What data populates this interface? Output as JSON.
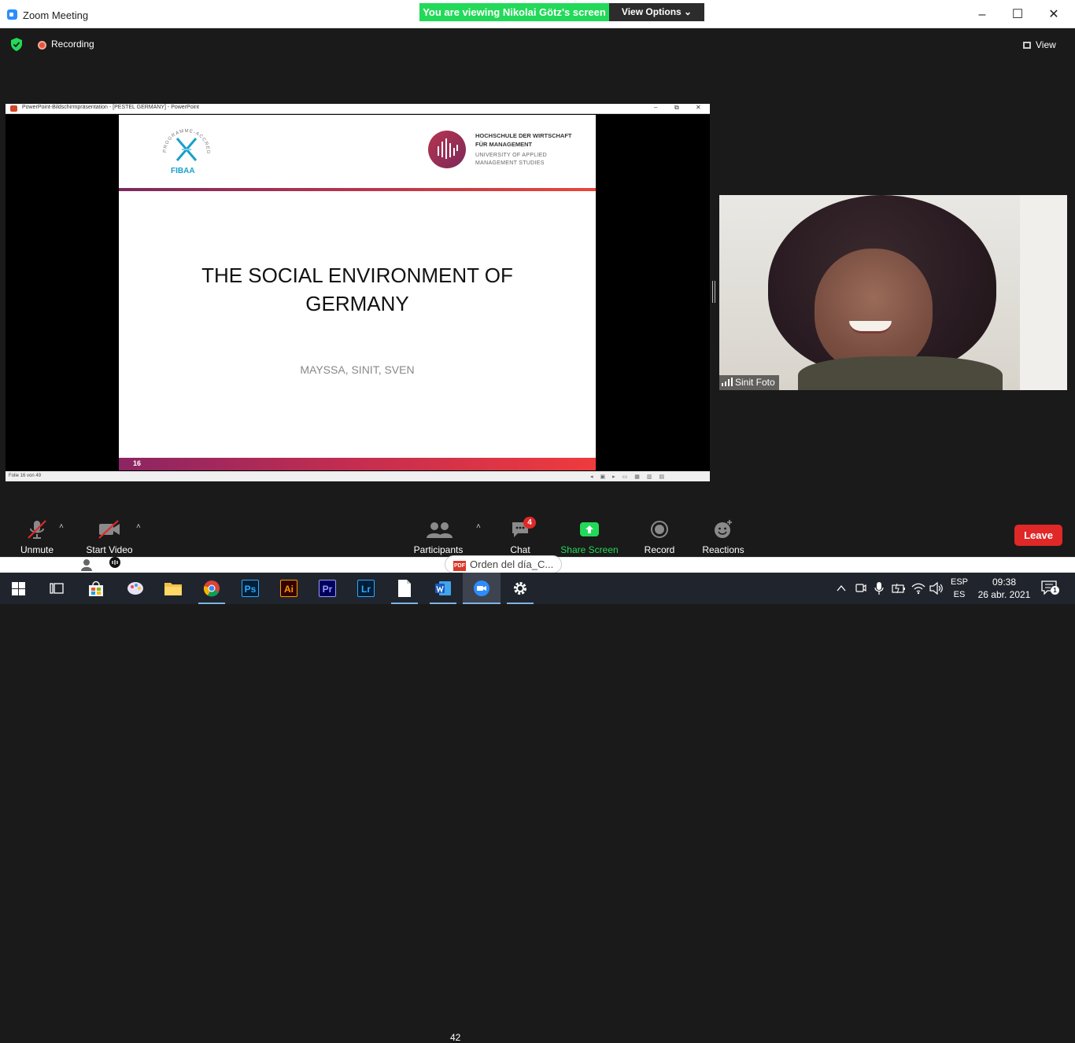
{
  "window": {
    "title": "Zoom Meeting",
    "minimize": "–",
    "maximize": "☐",
    "close": "✕"
  },
  "banner": {
    "viewing": "You are viewing Nikolai Götz's screen",
    "view_options": "View Options ⌄"
  },
  "meeting": {
    "recording_label": "Recording",
    "view_label": "View"
  },
  "shared_screen": {
    "window_title": "PowerPoint-Bildschirmpräsentation - [PESTEL GERMANY] - PowerPoint",
    "controls": [
      "–",
      "⧉",
      "✕"
    ],
    "slide": {
      "headline_line1": "THE SOCIAL ENVIRONMENT OF",
      "headline_line2": "GERMANY",
      "authors": "MAYSSA, SINIT, SVEN",
      "slide_number": "16",
      "fibaa_text": "FIBAA",
      "accreditation_text": "PROGRAMME-ACCREDITED",
      "school_name_line1": "HOCHSCHULE DER WIRTSCHAFT",
      "school_name_line2": "FÜR MANAGEMENT",
      "school_sub_line1": "UNIVERSITY OF APPLIED",
      "school_sub_line2": "MANAGEMENT STUDIES"
    },
    "status_text": "Folie 16 von 49"
  },
  "participant_video": {
    "name": "Sinit Foto"
  },
  "toolbar": {
    "unmute": "Unmute",
    "start_video": "Start Video",
    "participants": "Participants",
    "participant_count": "42",
    "chat": "Chat",
    "chat_badge": "4",
    "share_screen": "Share Screen",
    "record": "Record",
    "reactions": "Reactions",
    "leave": "Leave",
    "caret": "˄"
  },
  "underlying": {
    "pdf_badge": "PDF",
    "pdf_chip": "Orden del día_C..."
  },
  "taskbar": {
    "apps": [
      {
        "name": "ps",
        "label": "Ps",
        "color": "#31a8ff",
        "bg": "#001e36"
      },
      {
        "name": "ai",
        "label": "Ai",
        "color": "#ff9a00",
        "bg": "#330000"
      },
      {
        "name": "pr",
        "label": "Pr",
        "color": "#9999ff",
        "bg": "#00005b"
      },
      {
        "name": "lr",
        "label": "Lr",
        "color": "#31a8ff",
        "bg": "#001e36"
      }
    ],
    "lang_line1": "ESP",
    "lang_line2": "ES",
    "time": "09:38",
    "date": "26 abr. 2021",
    "notifications": "1"
  },
  "colors": {
    "zoom_blue": "#2d8cff",
    "banner_green": "#23d959",
    "leave_red": "#e02828",
    "share_green": "#23d959"
  }
}
